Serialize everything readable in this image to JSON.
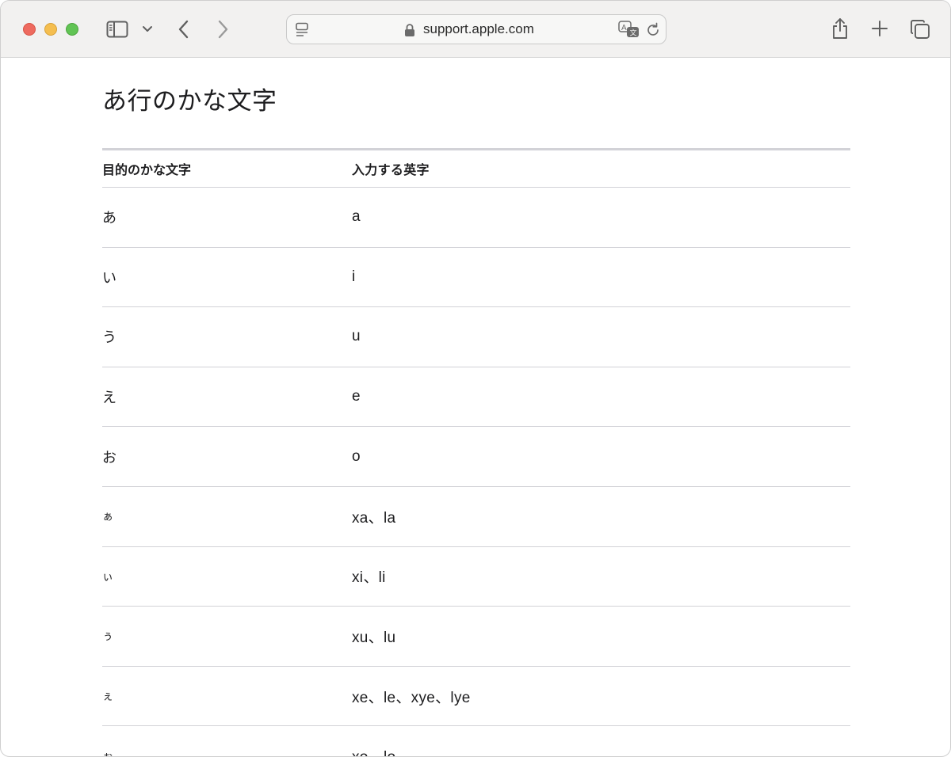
{
  "browser": {
    "url": "support.apple.com"
  },
  "page": {
    "title": "あ行のかな文字",
    "table": {
      "headers": [
        "目的のかな文字",
        "入力する英字"
      ],
      "rows": [
        {
          "kana": "あ",
          "romaji": "a"
        },
        {
          "kana": "い",
          "romaji": "i"
        },
        {
          "kana": "う",
          "romaji": "u"
        },
        {
          "kana": "え",
          "romaji": "e"
        },
        {
          "kana": "お",
          "romaji": "o"
        },
        {
          "kana": "ぁ",
          "romaji": "xa、la"
        },
        {
          "kana": "ぃ",
          "romaji": "xi、li"
        },
        {
          "kana": "ぅ",
          "romaji": "xu、lu"
        },
        {
          "kana": "ぇ",
          "romaji": "xe、le、xye、lye"
        },
        {
          "kana": "ぉ",
          "romaji": "xo、lo"
        }
      ]
    }
  },
  "icons": {
    "sidebar": "sidebar-icon",
    "chevron": "chevron-down-icon",
    "back": "back-arrow-icon",
    "forward": "forward-arrow-icon",
    "reader": "reader-icon",
    "lock": "lock-icon",
    "translate": "translate-icon",
    "reload": "reload-icon",
    "share": "share-icon",
    "new_tab": "plus-icon",
    "tab_overview": "tabs-icon"
  }
}
